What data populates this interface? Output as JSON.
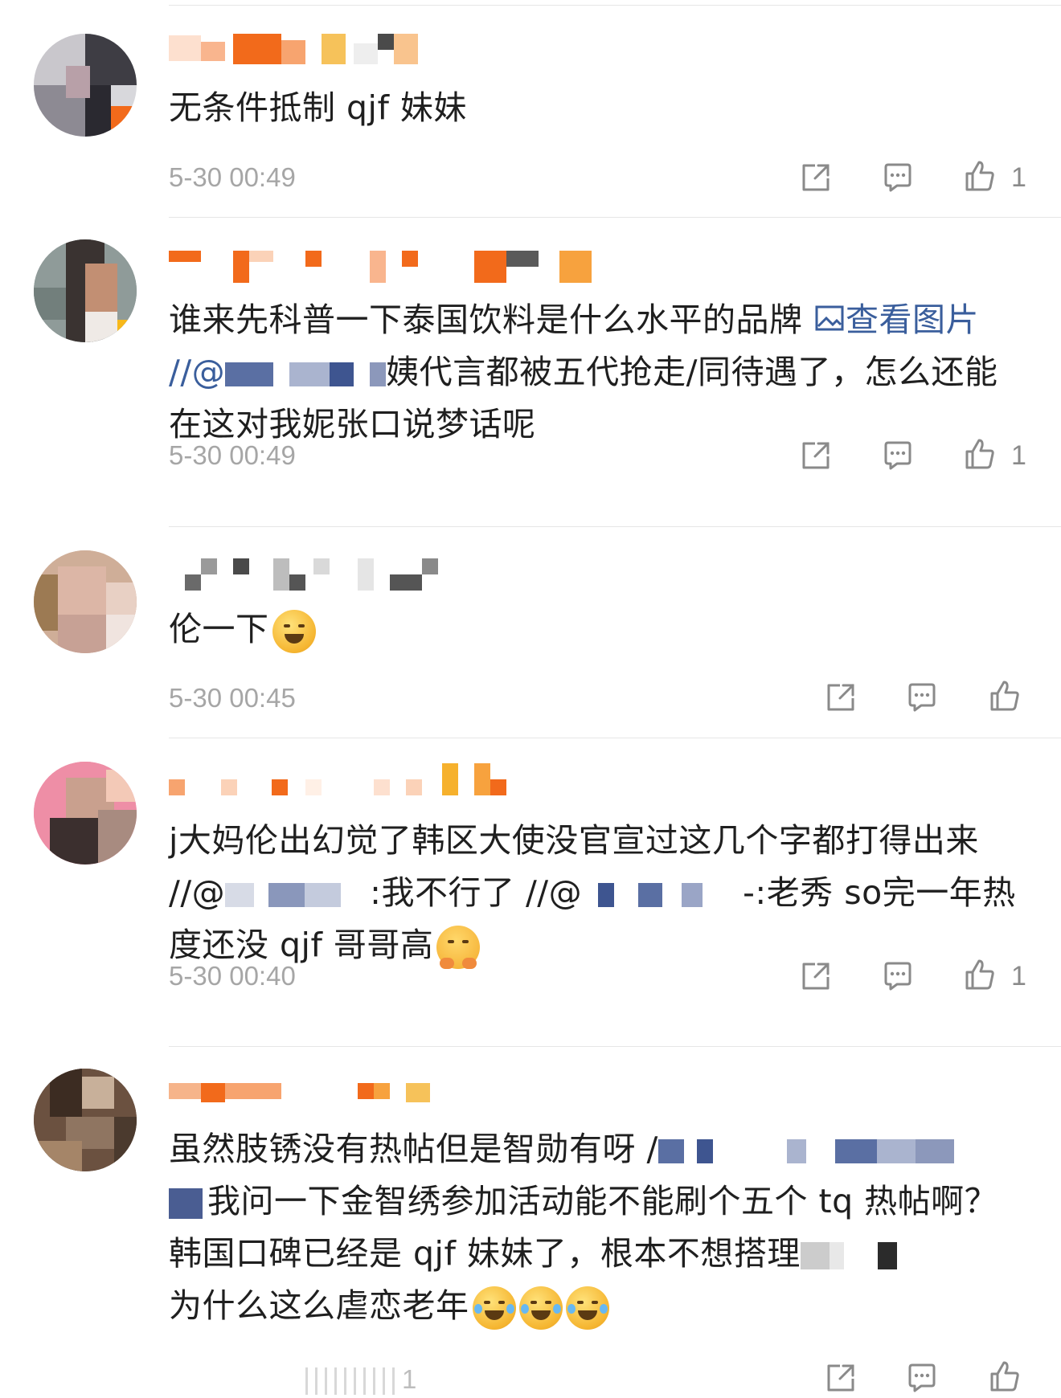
{
  "comments": [
    {
      "text": "无条件抵制 qjf 妹妹",
      "time": "5-30 00:49",
      "likes": "1"
    },
    {
      "text_part1": "谁来先科普一下泰国饮料是什么水平的品牌 ",
      "view_image_label": "查看图片",
      "mention_prefix": " //@",
      "text_part2": "姨代言都被五代抢走/同待遇了，怎么还能在这对我妮张口说梦话呢",
      "time": "5-30 00:49",
      "likes": "1"
    },
    {
      "text": "伦一下",
      "time": "5-30 00:45",
      "likes": ""
    },
    {
      "text_part1": "j大妈伦出幻觉了韩区大使没官宣过这几个字都打得出来 //@",
      "text_part2": ":我不行了 //@",
      "text_part3": "-:老秀 so完一年热度还没 qjf 哥哥高",
      "time": "5-30 00:40",
      "likes": "1"
    },
    {
      "text_part1": "虽然肢锈没有热帖但是智勋有呀 /",
      "text_part2": "我问一下金智绣参加活动能不能刷个五个 tq 热帖啊？韩国口碑已经是 qjf 妹妹了，根本不想搭理",
      "text_part3": "为什么这么虐恋老年",
      "time_partial": "1"
    }
  ],
  "icons": [
    "share-icon",
    "comment-icon",
    "like-icon"
  ],
  "colors": {
    "link": "#3a5e9c",
    "time": "#a6a6a6",
    "divider": "#e6e6e6"
  }
}
